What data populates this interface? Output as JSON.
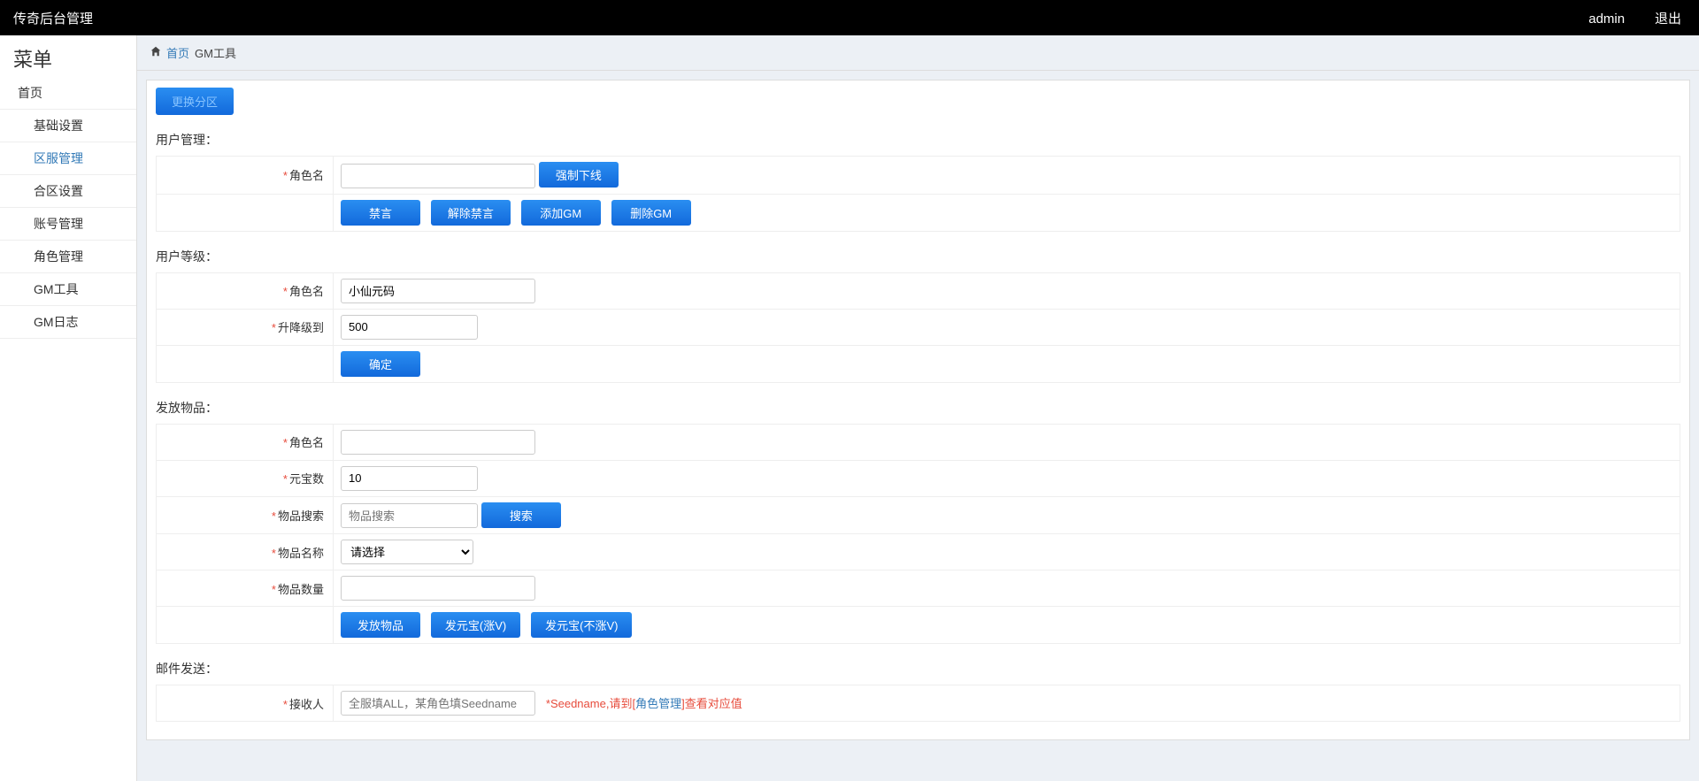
{
  "header": {
    "brand": "传奇后台管理",
    "user": "admin",
    "logout": "退出"
  },
  "sidebar": {
    "title": "菜单",
    "items": [
      {
        "label": "首页",
        "indent": false,
        "active": false
      },
      {
        "label": "基础设置",
        "indent": true,
        "active": false
      },
      {
        "label": "区服管理",
        "indent": true,
        "active": true
      },
      {
        "label": "合区设置",
        "indent": true,
        "active": false
      },
      {
        "label": "账号管理",
        "indent": true,
        "active": false
      },
      {
        "label": "角色管理",
        "indent": true,
        "active": false
      },
      {
        "label": "GM工具",
        "indent": true,
        "active": false
      },
      {
        "label": "GM日志",
        "indent": true,
        "active": false
      }
    ]
  },
  "breadcrumb": {
    "home": "首页",
    "current": "GM工具"
  },
  "switch_zone": "更换分区",
  "sections": {
    "user_manage": {
      "title": "用户管理：",
      "role_label": "角色名",
      "role_value": "",
      "force_offline": "强制下线",
      "ban": "禁言",
      "unban": "解除禁言",
      "add_gm": "添加GM",
      "del_gm": "删除GM"
    },
    "user_level": {
      "title": "用户等级：",
      "role_label": "角色名",
      "role_value": "小仙元码",
      "level_label": "升降级到",
      "level_value": "500",
      "confirm": "确定"
    },
    "give_item": {
      "title": "发放物品：",
      "role_label": "角色名",
      "role_value": "",
      "yuanbao_label": "元宝数",
      "yuanbao_value": "10",
      "search_label": "物品搜索",
      "search_placeholder": "物品搜索",
      "search_btn": "搜索",
      "item_name_label": "物品名称",
      "item_name_select": "请选择",
      "item_qty_label": "物品数量",
      "item_qty_value": "",
      "give_btn": "发放物品",
      "give_yuanbao_v": "发元宝(涨V)",
      "give_yuanbao_nv": "发元宝(不涨V)"
    },
    "mail": {
      "title": "邮件发送：",
      "receiver_label": "接收人",
      "receiver_placeholder": "全服填ALL，某角色填Seedname",
      "hint_prefix": "*Seedname,请到[",
      "hint_link": "角色管理",
      "hint_suffix": "]查看对应值"
    }
  }
}
